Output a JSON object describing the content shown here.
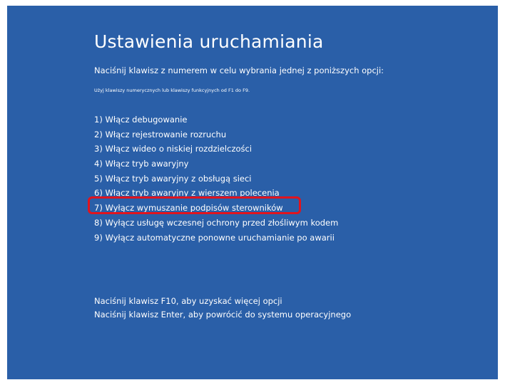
{
  "screen": {
    "title": "Ustawienia uruchamiania",
    "subtitle": "Naciśnij klawisz z numerem w celu wybrania jednej z poniższych opcji:",
    "hint": "Użyj klawiszy numerycznych lub klawiszy funkcyjnych od F1 do F9.",
    "options": [
      "1) Włącz debugowanie",
      "2) Włącz rejestrowanie rozruchu",
      "3) Włącz wideo o niskiej rozdzielczości",
      "4) Włącz tryb awaryjny",
      "5) Włącz tryb awaryjny z obsługą sieci",
      "6) Włącz tryb awaryjny z wierszem polecenia",
      "7) Wyłącz wymuszanie podpisów sterowników",
      "8) Wyłącz usługę wczesnej ochrony przed złośliwym kodem",
      "9) Wyłącz automatyczne ponowne uruchamianie po awarii"
    ],
    "footer": {
      "more_options": "Naciśnij klawisz F10, aby uzyskać więcej opcji",
      "return": "Naciśnij klawisz Enter, aby powrócić do systemu operacyjnego"
    },
    "highlighted_option_index": 6
  },
  "colors": {
    "background": "#2a5fa8",
    "text": "#ffffff",
    "highlight": "#e0141e"
  }
}
